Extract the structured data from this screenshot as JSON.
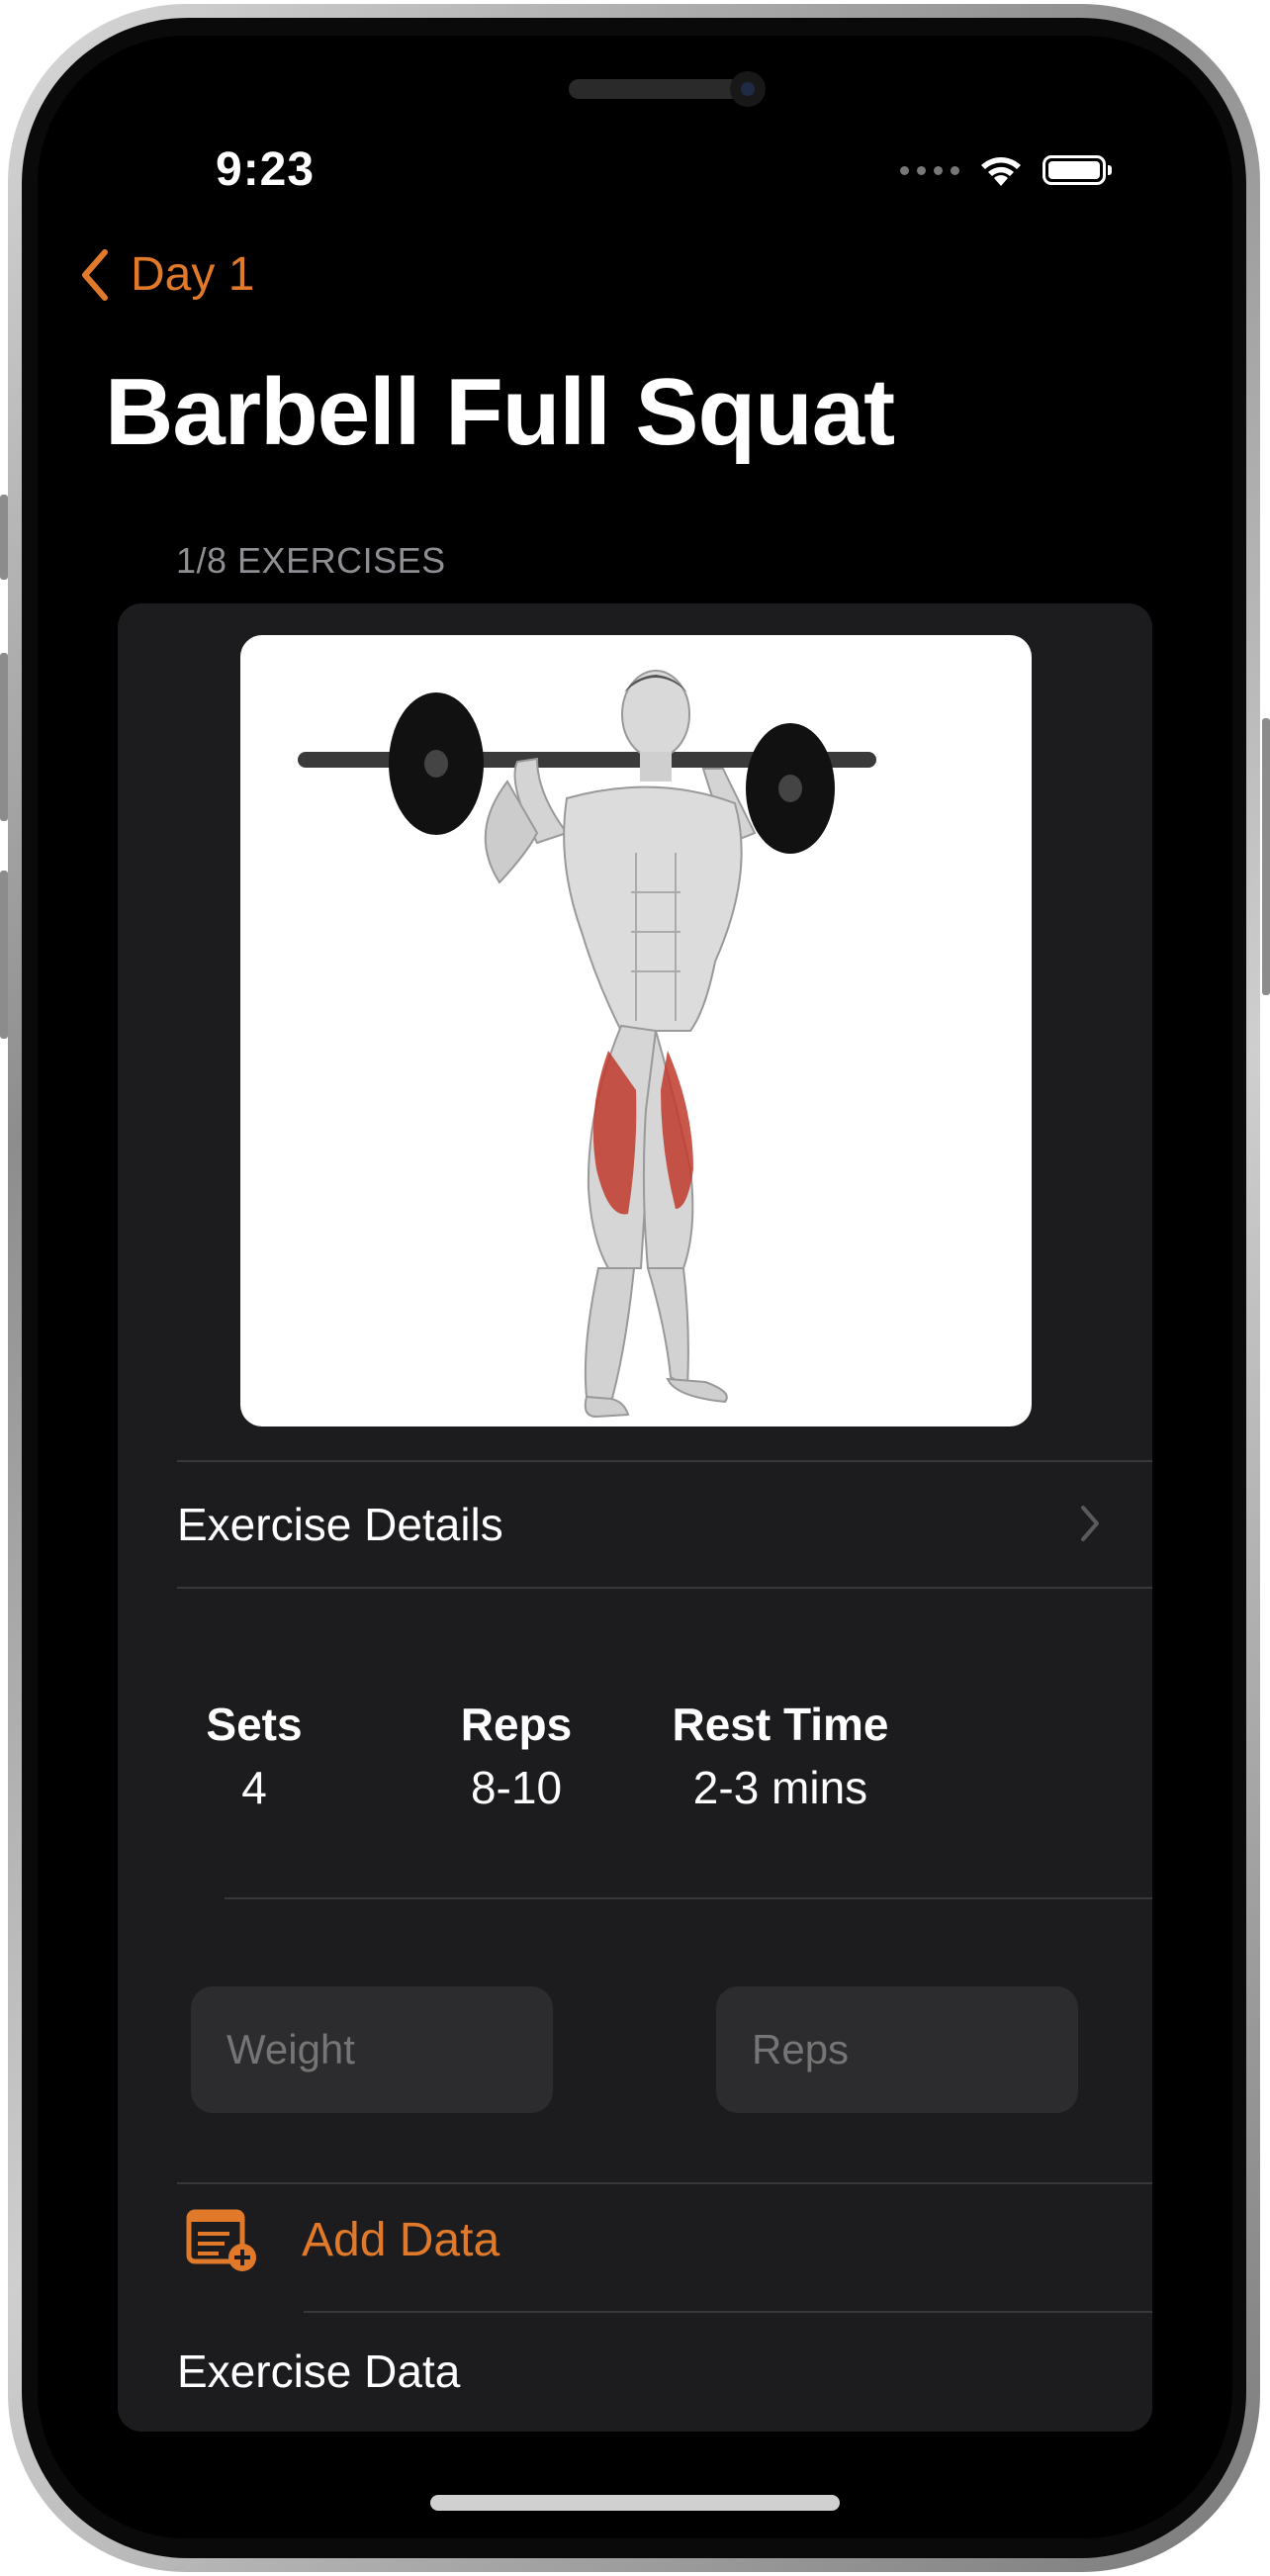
{
  "status_bar": {
    "time": "9:23"
  },
  "nav": {
    "back_label": "Day 1"
  },
  "page": {
    "title": "Barbell Full Squat"
  },
  "section": {
    "header": "1/8 EXERCISES"
  },
  "card": {
    "details_label": "Exercise Details",
    "stats": [
      {
        "label": "Sets",
        "value": "4"
      },
      {
        "label": "Reps",
        "value": "8-10"
      },
      {
        "label": "Rest Time",
        "value": "2-3 mins"
      }
    ],
    "inputs": {
      "weight_placeholder": "Weight",
      "reps_placeholder": "Reps"
    },
    "add_data_label": "Add Data",
    "exercise_data_label": "Exercise Data"
  },
  "colors": {
    "accent": "#e07a2a",
    "background": "#000000",
    "card": "#1c1c1e",
    "muscle_highlight": "#c0392b"
  }
}
